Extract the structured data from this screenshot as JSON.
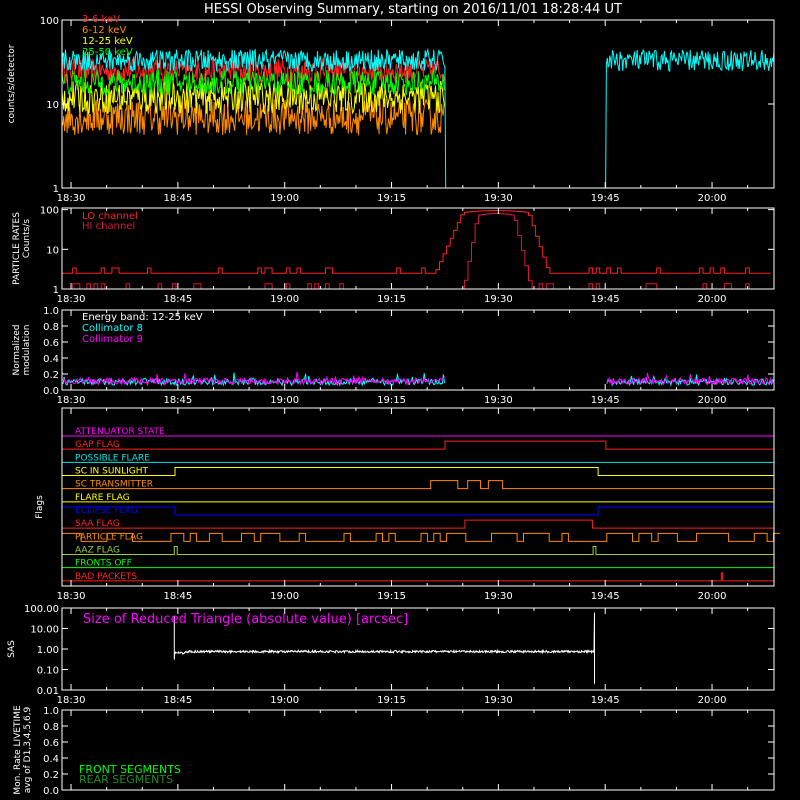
{
  "title": "HESSI Observing Summary, starting on 2016/11/01 18:28:44 UT",
  "time_axis": {
    "labels": [
      "18:30",
      "18:45",
      "19:00",
      "19:15",
      "19:30",
      "19:45",
      "20:00"
    ],
    "minutes": [
      0,
      15,
      30,
      45,
      60,
      75,
      90
    ],
    "range_minutes": [
      -1.27,
      98.7
    ]
  },
  "chart_data": [
    {
      "type": "line",
      "panel": "count_rates",
      "ylabel": "counts/s/detector",
      "yscale": "log",
      "ylim": [
        1,
        100
      ],
      "ytick_labels": [
        "1",
        "10",
        "100"
      ],
      "ytick_values": [
        1,
        10,
        100
      ],
      "gap_minutes": [
        52.5,
        75.1
      ],
      "series": [
        {
          "name": "3-6 keV",
          "color": "#ff2020",
          "level": 25,
          "noise": 0.35,
          "gap_drop": false
        },
        {
          "name": "6-12 keV",
          "color": "#ff8c00",
          "level": 7,
          "noise": 0.5,
          "gap_drop": false
        },
        {
          "name": "12-25 keV",
          "color": "#ffff00",
          "level": 12,
          "noise": 0.45,
          "gap_drop": false
        },
        {
          "name": "25-50 keV",
          "color": "#00ff00",
          "level": 18,
          "noise": 0.35,
          "gap_drop": false
        },
        {
          "name": "",
          "color": "#00ffff",
          "level": 33,
          "noise": 0.3,
          "gap_drop": true
        }
      ]
    },
    {
      "type": "line",
      "panel": "particle_rates",
      "ylabel": "PARTICLE RATES",
      "ylabel2": "Counts/s",
      "yscale": "log",
      "ylim": [
        1,
        110
      ],
      "ytick_labels": [
        "1",
        "10",
        "100"
      ],
      "ytick_values": [
        1,
        10,
        100
      ],
      "series": [
        {
          "name": "LO channel",
          "color": "#ff2020",
          "baseline": 2.5,
          "peak": 95,
          "rise": [
            51,
            55
          ],
          "fall": [
            64,
            67
          ]
        },
        {
          "name": "HI channel",
          "color": "#dc143c",
          "baseline": 1,
          "peak": 80,
          "rise": [
            55,
            57
          ],
          "fall": [
            62,
            64.5
          ]
        }
      ]
    },
    {
      "type": "line",
      "panel": "modulation",
      "ylabel": "Normalized",
      "ylabel2": "modulation",
      "ylim": [
        0,
        1
      ],
      "ytick_labels": [
        "0.0",
        "0.2",
        "0.4",
        "0.6",
        "0.8",
        "1.0"
      ],
      "ytick_values": [
        0,
        0.2,
        0.4,
        0.6,
        0.8,
        1.0
      ],
      "legend_title": "Energy band: 12-25 keV",
      "gap_minutes": [
        52.5,
        75.1
      ],
      "series": [
        {
          "name": "Collimator 8",
          "color": "#00ffff",
          "level": 0.1
        },
        {
          "name": "Collimator 9",
          "color": "#ff00ff",
          "level": 0.11
        }
      ]
    },
    {
      "type": "line",
      "panel": "flags",
      "ylabel": "Flags",
      "flags": [
        {
          "name": "ATTENUATOR STATE",
          "color": "#ff00ff",
          "intervals": []
        },
        {
          "name": "GAP FLAG",
          "color": "#ff2020",
          "intervals": [
            [
              52.5,
              75.1
            ]
          ]
        },
        {
          "name": "POSSIBLE FLARE",
          "color": "#00e5e5",
          "intervals": []
        },
        {
          "name": "SC IN SUNLIGHT",
          "color": "#ffff00",
          "intervals": [
            [
              14.6,
              74.0
            ]
          ]
        },
        {
          "name": "SC TRANSMITTER",
          "color": "#ff8c00",
          "intervals": [
            [
              50.5,
              54.3
            ],
            [
              55.7,
              57.5
            ],
            [
              58.6,
              60.6
            ]
          ]
        },
        {
          "name": "FLARE FLAG",
          "color": "#ffff00",
          "intervals": []
        },
        {
          "name": "ECLIPSE FLAG",
          "color": "#0000ff",
          "intervals": [
            [
              -1.27,
              14.6
            ],
            [
              74.0,
              98.7
            ]
          ]
        },
        {
          "name": "SAA FLAG",
          "color": "#ff2020",
          "intervals": [
            [
              55.3,
              73.2
            ]
          ]
        },
        {
          "name": "PARTICLE FLAG",
          "color": "#ff8c00",
          "intervals": []
        },
        {
          "name": "AAZ FLAG",
          "color": "#9acd32",
          "intervals": [
            [
              14.5,
              14.9
            ],
            [
              73.3,
              73.7
            ]
          ]
        },
        {
          "name": "FRONTS OFF",
          "color": "#00ff00",
          "intervals": []
        },
        {
          "name": "BAD PACKETS",
          "color": "#ff2020",
          "intervals": [
            [
              91.3,
              91.5
            ]
          ]
        }
      ]
    },
    {
      "type": "line",
      "panel": "sas",
      "ylabel": "SAS",
      "annotation": "Size of Reduced Triangle (absolute value) [arcsec]",
      "yscale": "log",
      "ylim": [
        0.01,
        100
      ],
      "ytick_labels": [
        "0.01",
        "0.10",
        "1.00",
        "10.00",
        "100.00"
      ],
      "ytick_values": [
        0.01,
        0.1,
        1,
        10,
        100
      ],
      "series": [
        {
          "name": "",
          "color": "#ffffff",
          "start": 14.5,
          "end": 73.5,
          "level": 0.75
        }
      ]
    },
    {
      "type": "line",
      "panel": "livetime",
      "ylabel": "Mon. Rate LIVETIME",
      "ylabel2": "avg of D1,3,4,5,6,9",
      "ylim": [
        0,
        1
      ],
      "ytick_labels": [
        "0.0",
        "0.2",
        "0.4",
        "0.6",
        "0.8",
        "1.0"
      ],
      "ytick_values": [
        0,
        0.2,
        0.4,
        0.6,
        0.8,
        1.0
      ],
      "series": [
        {
          "name": "FRONT SEGMENTS",
          "color": "#00ff00"
        },
        {
          "name": "REAR SEGMENTS",
          "color": "#228b22"
        }
      ]
    }
  ]
}
